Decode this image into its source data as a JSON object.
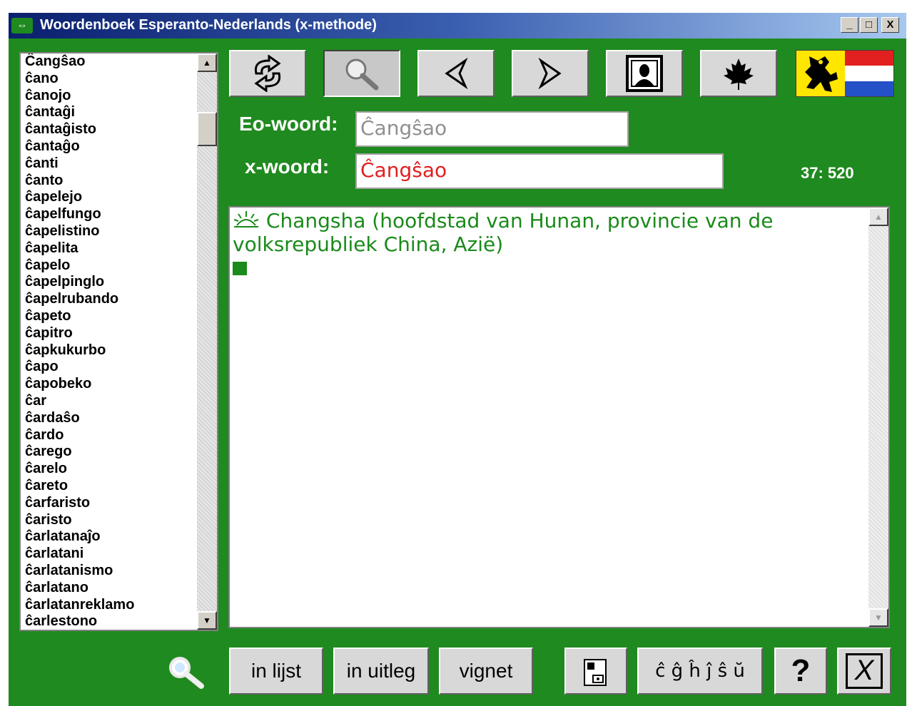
{
  "window": {
    "title": "Woordenboek Esperanto-Nederlands (x-methode)",
    "controls": {
      "minimize": "_",
      "maximize": "□",
      "close": "X"
    }
  },
  "word_list": {
    "items": [
      "Ĉangŝao",
      "ĉano",
      "ĉanojo",
      "ĉantaĝi",
      "ĉantaĝisto",
      "ĉantaĝo",
      "ĉanti",
      "ĉanto",
      "ĉapelejo",
      "ĉapelfungo",
      "ĉapelistino",
      "ĉapelita",
      "ĉapelo",
      "ĉapelpinglo",
      "ĉapelrubando",
      "ĉapeto",
      "ĉapitro",
      "ĉapkukurbo",
      "ĉapo",
      "ĉapobeko",
      "ĉar",
      "ĉardaŝo",
      "ĉardo",
      "ĉarego",
      "ĉarelo",
      "ĉareto",
      "ĉarfaristo",
      "ĉaristo",
      "ĉarlatanaĵo",
      "ĉarlatani",
      "ĉarlatanismo",
      "ĉarlatano",
      "ĉarlatanreklamo",
      "ĉarlestono"
    ]
  },
  "toolbar": {
    "buttons": [
      {
        "name": "swap-direction",
        "icon": "swap-arrows-icon"
      },
      {
        "name": "search",
        "icon": "magnifier-icon",
        "pressed": true
      },
      {
        "name": "previous",
        "icon": "left-arrow-icon"
      },
      {
        "name": "next",
        "icon": "right-arrow-icon"
      },
      {
        "name": "picture",
        "icon": "mona-lisa-picture-icon"
      },
      {
        "name": "maple-leaf",
        "icon": "maple-leaf-icon"
      }
    ],
    "flag": "flemish-dutch-flag"
  },
  "fields": {
    "eo_label": "Eo-woord:",
    "eo_value": "Ĉangŝao",
    "x_label": "x-woord:",
    "x_value": "Ĉangŝao"
  },
  "counter": "37: 520",
  "definition": {
    "icon": "sun-icon",
    "text": "Changsha (hoofdstad van Hunan, provincie van de volksrepubliek China, Azië)"
  },
  "bottom": {
    "search_icon": "magnifier-icon",
    "in_lijst": "in lijst",
    "in_uitleg": "in uitleg",
    "vignet": "vignet",
    "chars": "ĉ ĝ ĥ ĵ ŝ ŭ",
    "help": "?",
    "exit": "X"
  },
  "colors": {
    "background": "#1f8a1f",
    "definition_text": "#1a8a1a",
    "x_word_text": "#e02020",
    "eo_word_text": "#909090"
  }
}
